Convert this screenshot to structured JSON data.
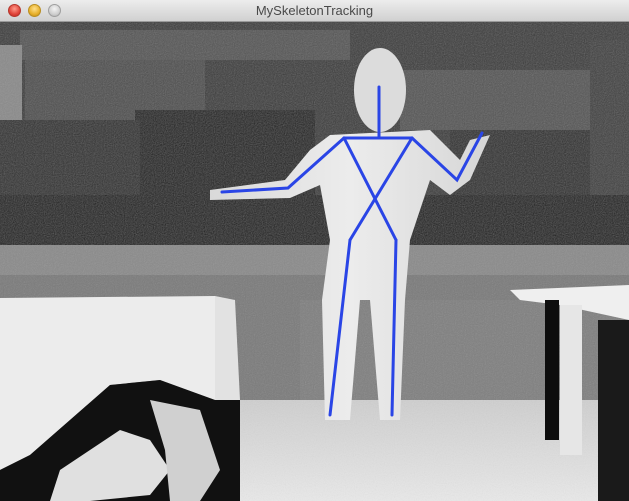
{
  "window": {
    "title": "MySkeletonTracking"
  },
  "colors": {
    "skeleton": "#2a45e6"
  },
  "icons": [
    "close-button",
    "minimize-button",
    "zoom-button"
  ]
}
